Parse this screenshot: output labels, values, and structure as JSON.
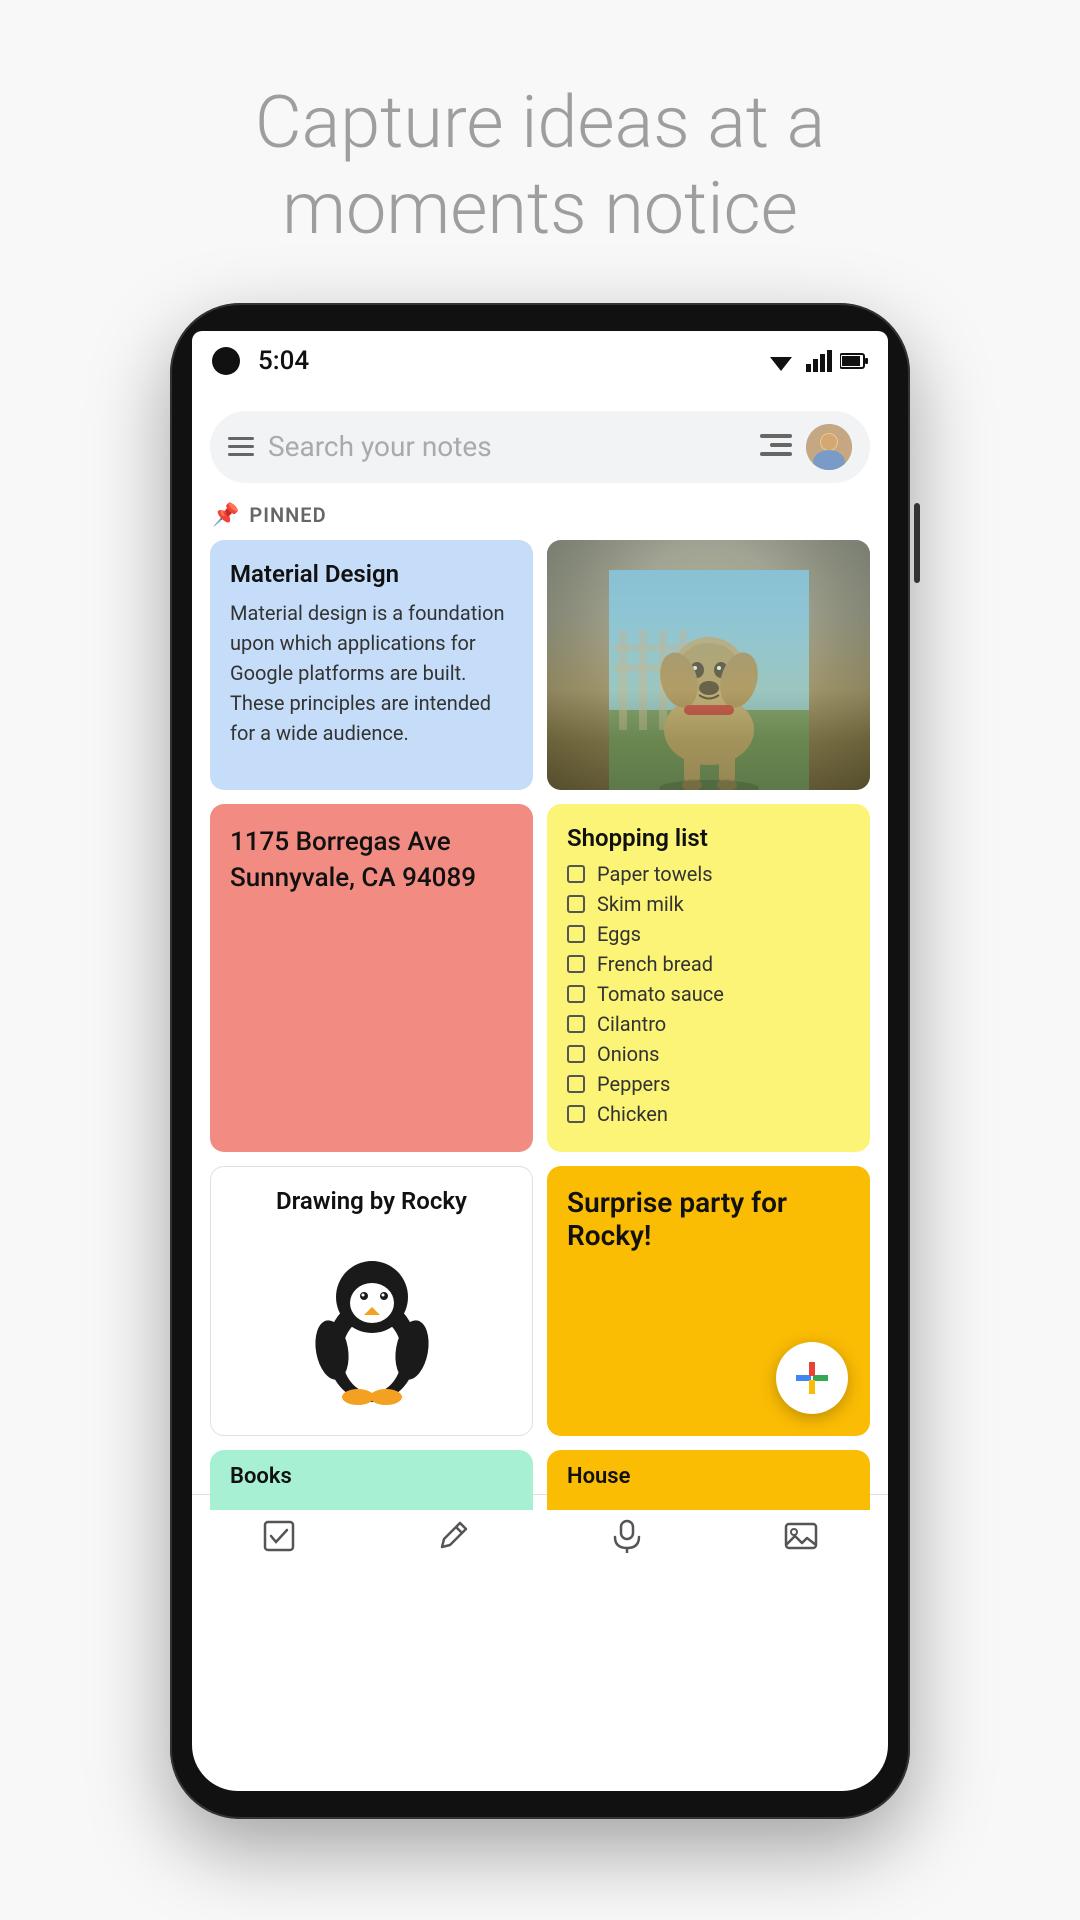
{
  "hero": {
    "line1": "Capture ideas at a",
    "line2": "moments notice"
  },
  "status_bar": {
    "time": "5:04"
  },
  "search": {
    "placeholder": "Search your notes"
  },
  "pinned_label": "PINNED",
  "notes": {
    "note1": {
      "title": "Material Design",
      "body": "Material design is a foundation upon which applications for Google platforms are built. These principles are intended for a wide audience."
    },
    "note2": {
      "address": "1175 Borregas Ave Sunnyvale, CA 94089"
    },
    "note3": {
      "title": "Drawing by Rocky"
    },
    "shopping": {
      "title": "Shopping list",
      "items": [
        "Paper towels",
        "Skim milk",
        "Eggs",
        "French bread",
        "Tomato sauce",
        "Cilantro",
        "Onions",
        "Peppers",
        "Chicken"
      ]
    },
    "note4": {
      "title": "Surprise party for Rocky!"
    },
    "note5": {
      "title": "Books"
    },
    "note6": {
      "title": "House"
    }
  },
  "bottom_nav": {
    "icons": [
      "check-square-icon",
      "pencil-icon",
      "mic-icon",
      "image-icon"
    ]
  }
}
